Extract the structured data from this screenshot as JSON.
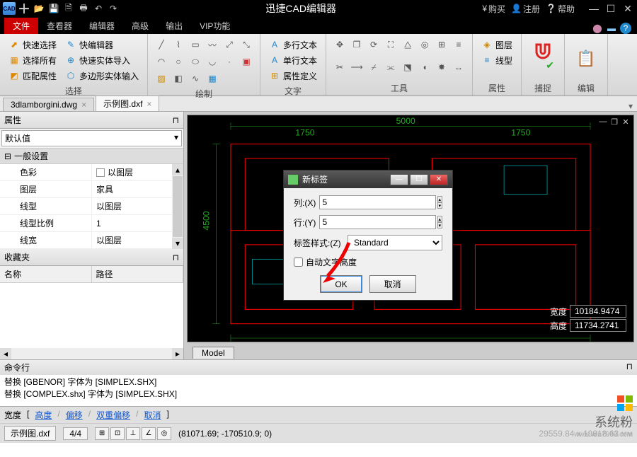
{
  "app": {
    "title": "迅捷CAD编辑器"
  },
  "titlebar": {
    "buy": "购买",
    "register": "注册",
    "help": "帮助"
  },
  "tabs": {
    "file": "文件",
    "viewer": "查看器",
    "editor": "编辑器",
    "advanced": "高级",
    "output": "输出",
    "vip": "VIP功能"
  },
  "ribbon": {
    "select": {
      "label": "选择",
      "quick_select": "快速选择",
      "select_all": "选择所有",
      "match_prop": "匹配属性",
      "quick_edit": "快编辑器",
      "quick_import": "快速实体导入",
      "poly_input": "多边形实体输入"
    },
    "draw": {
      "label": "绘制"
    },
    "text": {
      "label": "文字",
      "mtext": "多行文本",
      "stext": "单行文本",
      "attdef": "属性定义"
    },
    "tools": {
      "label": "工具"
    },
    "props": {
      "label": "属性",
      "layer": "图层",
      "linetype": "线型"
    },
    "capture": {
      "label": "捕捉"
    },
    "edit": {
      "label": "编辑"
    }
  },
  "filetabs": {
    "f1": "3dlamborgini.dwg",
    "f2": "示例图.dxf"
  },
  "props_panel": {
    "title": "属性",
    "combo": "默认值",
    "section": "一般设置",
    "rows": [
      {
        "k": "色彩",
        "v": "以图层"
      },
      {
        "k": "图层",
        "v": "家具"
      },
      {
        "k": "线型",
        "v": "以图层"
      },
      {
        "k": "线型比例",
        "v": "1"
      },
      {
        "k": "线宽",
        "v": "以图层"
      }
    ]
  },
  "fav_panel": {
    "title": "收藏夹",
    "col1": "名称",
    "col2": "路径"
  },
  "canvas": {
    "width_lbl": "宽度",
    "width_val": "10184.9474",
    "height_lbl": "高度",
    "height_val": "11734.2741",
    "model_tab": "Model"
  },
  "dialog": {
    "title": "新标签",
    "col_lbl": "列:(X)",
    "col_val": "5",
    "row_lbl": "行:(Y)",
    "row_val": "5",
    "style_lbl": "标签样式:(Z)",
    "style_val": "Standard",
    "auto_lbl": "自动文字高度",
    "ok": "OK",
    "cancel": "取消"
  },
  "cmd": {
    "title": "命令行",
    "line1": "替换 [GBENOR] 字体为 [SIMPLEX.SHX]",
    "line2": "替换 [COMPLEX.shx] 字体为 [SIMPLEX.SHX]"
  },
  "status1": {
    "width": "宽度",
    "br1": "[",
    "height": "高度",
    "sep": "/",
    "offset": "偏移",
    "dbl": "双重偏移",
    "cancel": "取消",
    "br2": "]"
  },
  "status2": {
    "file": "示例图.dxf",
    "progress": "4/4",
    "coords": "(81071.69; -170510.9; 0)",
    "zoom": "29559.84 x 19818.63 мм"
  },
  "watermark": {
    "txt1": "系统粉",
    "txt2": "www.win7999.com"
  }
}
